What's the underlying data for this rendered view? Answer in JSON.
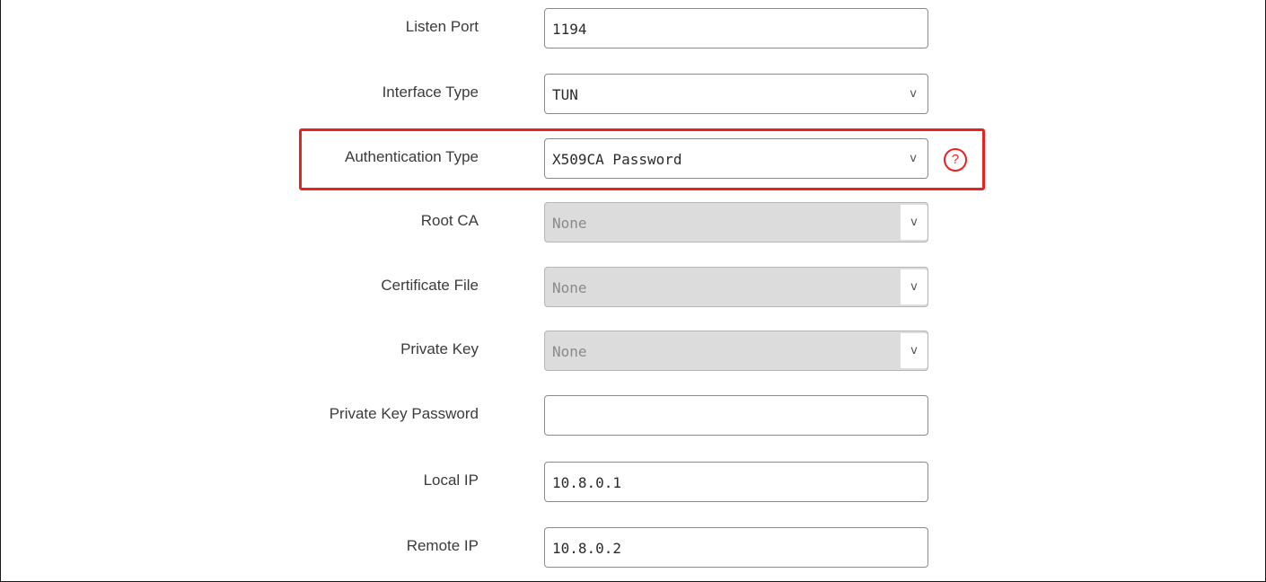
{
  "form": {
    "fields": [
      {
        "label": "Listen Port",
        "type": "input",
        "value": "1194",
        "disabled": false
      },
      {
        "label": "Interface Type",
        "type": "select",
        "value": "TUN",
        "disabled": false
      },
      {
        "label": "Authentication Type",
        "type": "select",
        "value": "X509CA Password",
        "disabled": false,
        "highlighted": true
      },
      {
        "label": "Root CA",
        "type": "select",
        "value": "None",
        "disabled": true
      },
      {
        "label": "Certificate File",
        "type": "select",
        "value": "None",
        "disabled": true
      },
      {
        "label": "Private Key",
        "type": "select",
        "value": "None",
        "disabled": true
      },
      {
        "label": "Private Key Password",
        "type": "input",
        "value": "",
        "disabled": false
      },
      {
        "label": "Local IP",
        "type": "input",
        "value": "10.8.0.1",
        "disabled": false
      },
      {
        "label": "Remote IP",
        "type": "input",
        "value": "10.8.0.2",
        "disabled": false
      }
    ],
    "chevron": "v",
    "help_icon": {
      "name": "question-circle-icon",
      "glyph": "?"
    }
  },
  "colors": {
    "highlight": "#e8231f",
    "disabled_bg": "#dcdcdc"
  }
}
